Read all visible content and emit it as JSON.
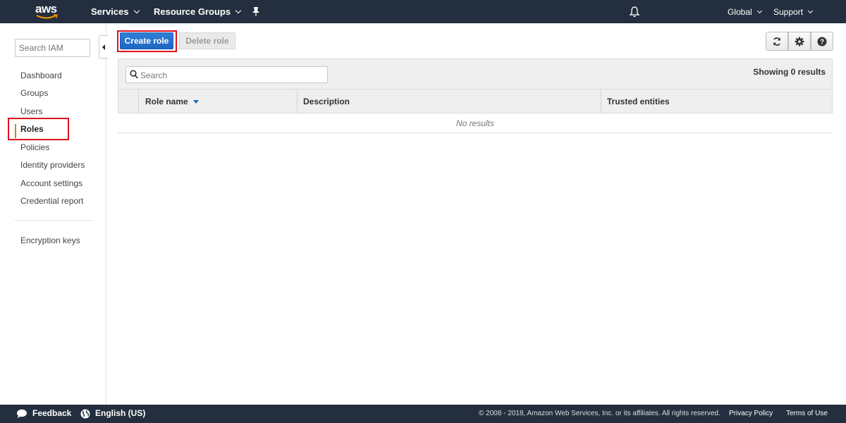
{
  "topnav": {
    "logo_text": "aws",
    "services_label": "Services",
    "resource_groups_label": "Resource Groups",
    "region_label": "Global",
    "support_label": "Support"
  },
  "sidebar": {
    "search_placeholder": "Search IAM",
    "items": [
      {
        "label": "Dashboard"
      },
      {
        "label": "Groups"
      },
      {
        "label": "Users"
      },
      {
        "label": "Roles",
        "active": true
      },
      {
        "label": "Policies"
      },
      {
        "label": "Identity providers"
      },
      {
        "label": "Account settings"
      },
      {
        "label": "Credential report"
      }
    ],
    "secondary_items": [
      {
        "label": "Encryption keys"
      }
    ]
  },
  "toolbar": {
    "create_role_label": "Create role",
    "delete_role_label": "Delete role",
    "refresh_icon": "refresh-icon",
    "settings_icon": "gear-icon",
    "help_icon": "help-icon"
  },
  "table": {
    "search_placeholder": "Search",
    "showing_text": "Showing 0 results",
    "columns": [
      "Role name",
      "Description",
      "Trusted entities"
    ],
    "empty_text": "No results"
  },
  "footer": {
    "feedback_label": "Feedback",
    "language_label": "English (US)",
    "copyright": "© 2008 - 2018, Amazon Web Services, Inc. or its affiliates. All rights reserved.",
    "privacy_label": "Privacy Policy",
    "terms_label": "Terms of Use"
  },
  "colors": {
    "nav_bg": "#232f3e",
    "primary_button": "#1d67c1",
    "active_indicator": "#e47911",
    "highlight_box": "#e0101c"
  }
}
